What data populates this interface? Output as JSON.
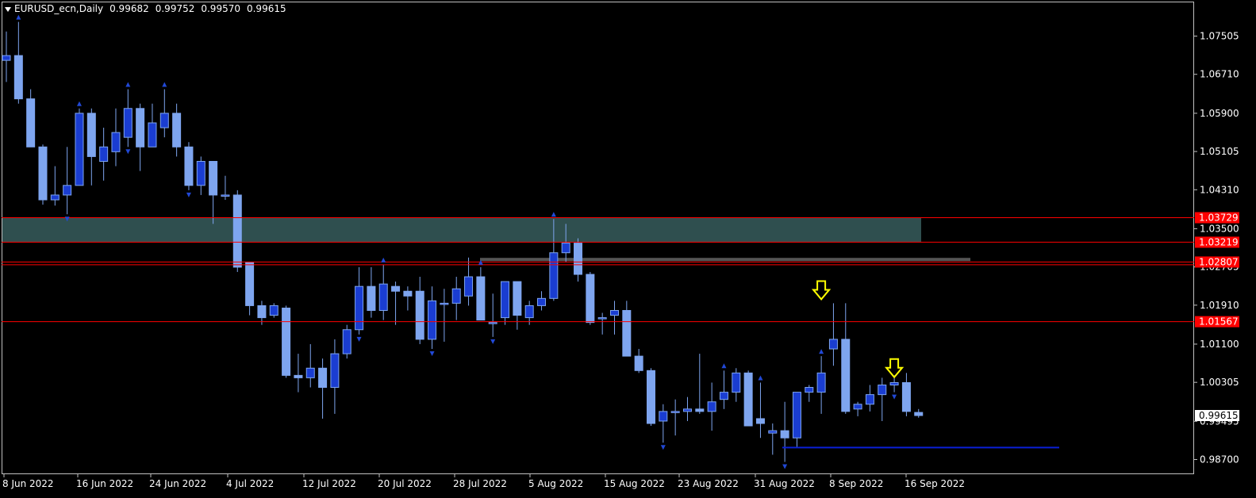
{
  "header": {
    "symbol": "EURUSD_ecn,Daily",
    "open": "0.99682",
    "high": "0.99752",
    "low": "0.99570",
    "close": "0.99615"
  },
  "colors": {
    "background": "#000000",
    "bull": "#1a3dd1",
    "bear": "#7ea5ef",
    "zone_fill": "#2f4f4f",
    "level_line": "#ff0000",
    "support_line": "#0a1fd6",
    "arrow": "#ffff00",
    "price_tag": "#ff0000"
  },
  "chart_data": {
    "type": "candlestick",
    "title": "EURUSD_ecn,Daily",
    "timeframe": "Daily",
    "ylim": [
      0.9815,
      1.082
    ],
    "y_ticks": [
      "1.07505",
      "1.06710",
      "1.05900",
      "1.05105",
      "1.04310",
      "1.03500",
      "1.02705",
      "1.01910",
      "1.01100",
      "1.00305",
      "0.99495",
      "0.98700"
    ],
    "x_ticks": [
      "8 Jun 2022",
      "16 Jun 2022",
      "24 Jun 2022",
      "4 Jul 2022",
      "12 Jul 2022",
      "20 Jul 2022",
      "28 Jul 2022",
      "5 Aug 2022",
      "15 Aug 2022",
      "23 Aug 2022",
      "31 Aug 2022",
      "8 Sep 2022",
      "16 Sep 2022"
    ],
    "current_price": "0.99615",
    "levels": [
      {
        "label": "1.03729",
        "value": 1.03729
      },
      {
        "label": "1.03219",
        "value": 1.03219
      },
      {
        "label": "1.02807",
        "value": 1.02807
      },
      {
        "label": "1.01567",
        "value": 1.01567
      }
    ],
    "zone": {
      "low": 1.03219,
      "high": 1.03729
    },
    "thin_zone_value": 1.0286,
    "support": 0.9895,
    "arrows": [
      {
        "date": "2022-09-08",
        "price": 1.0218
      },
      {
        "date": "2022-09-16",
        "price": 1.0056
      }
    ],
    "candles": [
      {
        "date": "2022-06-07",
        "o": 1.07,
        "h": 1.076,
        "l": 1.0655,
        "c": 1.071
      },
      {
        "date": "2022-06-08",
        "o": 1.071,
        "h": 1.078,
        "l": 1.061,
        "c": 1.062
      },
      {
        "date": "2022-06-09",
        "o": 1.062,
        "h": 1.064,
        "l": 1.052,
        "c": 1.052
      },
      {
        "date": "2022-06-10",
        "o": 1.052,
        "h": 1.0525,
        "l": 1.04,
        "c": 1.041
      },
      {
        "date": "2022-06-13",
        "o": 1.041,
        "h": 1.048,
        "l": 1.0398,
        "c": 1.042
      },
      {
        "date": "2022-06-14",
        "o": 1.042,
        "h": 1.052,
        "l": 1.038,
        "c": 1.044
      },
      {
        "date": "2022-06-15",
        "o": 1.044,
        "h": 1.06,
        "l": 1.044,
        "c": 1.059
      },
      {
        "date": "2022-06-16",
        "o": 1.059,
        "h": 1.06,
        "l": 1.044,
        "c": 1.05
      },
      {
        "date": "2022-06-17",
        "o": 1.049,
        "h": 1.056,
        "l": 1.045,
        "c": 1.052
      },
      {
        "date": "2022-06-20",
        "o": 1.051,
        "h": 1.06,
        "l": 1.048,
        "c": 1.055
      },
      {
        "date": "2022-06-21",
        "o": 1.054,
        "h": 1.064,
        "l": 1.052,
        "c": 1.06
      },
      {
        "date": "2022-06-22",
        "o": 1.06,
        "h": 1.061,
        "l": 1.047,
        "c": 1.052
      },
      {
        "date": "2022-06-23",
        "o": 1.052,
        "h": 1.061,
        "l": 1.052,
        "c": 1.057
      },
      {
        "date": "2022-06-24",
        "o": 1.056,
        "h": 1.064,
        "l": 1.054,
        "c": 1.059
      },
      {
        "date": "2022-06-27",
        "o": 1.059,
        "h": 1.061,
        "l": 1.05,
        "c": 1.052
      },
      {
        "date": "2022-06-28",
        "o": 1.052,
        "h": 1.053,
        "l": 1.043,
        "c": 1.044
      },
      {
        "date": "2022-06-29",
        "o": 1.044,
        "h": 1.05,
        "l": 1.042,
        "c": 1.049
      },
      {
        "date": "2022-06-30",
        "o": 1.049,
        "h": 1.049,
        "l": 1.036,
        "c": 1.042
      },
      {
        "date": "2022-07-01",
        "o": 1.042,
        "h": 1.046,
        "l": 1.041,
        "c": 1.042
      },
      {
        "date": "2022-07-04",
        "o": 1.042,
        "h": 1.043,
        "l": 1.026,
        "c": 1.027
      },
      {
        "date": "2022-07-05",
        "o": 1.028,
        "h": 1.028,
        "l": 1.017,
        "c": 1.019
      },
      {
        "date": "2022-07-06",
        "o": 1.019,
        "h": 1.02,
        "l": 1.015,
        "c": 1.0165
      },
      {
        "date": "2022-07-07",
        "o": 1.017,
        "h": 1.0195,
        "l": 1.0165,
        "c": 1.019
      },
      {
        "date": "2022-07-08",
        "o": 1.0185,
        "h": 1.019,
        "l": 1.004,
        "c": 1.0045
      },
      {
        "date": "2022-07-11",
        "o": 1.0045,
        "h": 1.009,
        "l": 1.001,
        "c": 1.004
      },
      {
        "date": "2022-07-12",
        "o": 1.004,
        "h": 1.011,
        "l": 1.002,
        "c": 1.006
      },
      {
        "date": "2022-07-13",
        "o": 1.006,
        "h": 1.008,
        "l": 0.9955,
        "c": 1.002
      },
      {
        "date": "2022-07-14",
        "o": 1.002,
        "h": 1.012,
        "l": 0.9965,
        "c": 1.009
      },
      {
        "date": "2022-07-15",
        "o": 1.009,
        "h": 1.015,
        "l": 1.008,
        "c": 1.014
      },
      {
        "date": "2022-07-18",
        "o": 1.014,
        "h": 1.027,
        "l": 1.013,
        "c": 1.023
      },
      {
        "date": "2022-07-19",
        "o": 1.023,
        "h": 1.027,
        "l": 1.0165,
        "c": 1.018
      },
      {
        "date": "2022-07-20",
        "o": 1.018,
        "h": 1.0275,
        "l": 1.016,
        "c": 1.0235
      },
      {
        "date": "2022-07-21",
        "o": 1.023,
        "h": 1.024,
        "l": 1.015,
        "c": 1.022
      },
      {
        "date": "2022-07-22",
        "o": 1.022,
        "h": 1.023,
        "l": 1.018,
        "c": 1.021
      },
      {
        "date": "2022-07-25",
        "o": 1.022,
        "h": 1.025,
        "l": 1.011,
        "c": 1.012
      },
      {
        "date": "2022-07-26",
        "o": 1.012,
        "h": 1.023,
        "l": 1.01,
        "c": 1.02
      },
      {
        "date": "2022-07-27",
        "o": 1.0195,
        "h": 1.0225,
        "l": 1.0115,
        "c": 1.0195
      },
      {
        "date": "2022-07-28",
        "o": 1.0195,
        "h": 1.025,
        "l": 1.016,
        "c": 1.0225
      },
      {
        "date": "2022-07-29",
        "o": 1.021,
        "h": 1.029,
        "l": 1.019,
        "c": 1.025
      },
      {
        "date": "2022-08-01",
        "o": 1.025,
        "h": 1.027,
        "l": 1.016,
        "c": 1.016
      },
      {
        "date": "2022-08-02",
        "o": 1.0155,
        "h": 1.0215,
        "l": 1.0125,
        "c": 1.0155
      },
      {
        "date": "2022-08-03",
        "o": 1.0165,
        "h": 1.024,
        "l": 1.015,
        "c": 1.024
      },
      {
        "date": "2022-08-04",
        "o": 1.024,
        "h": 1.024,
        "l": 1.014,
        "c": 1.017
      },
      {
        "date": "2022-08-05",
        "o": 1.0165,
        "h": 1.02,
        "l": 1.015,
        "c": 1.019
      },
      {
        "date": "2022-08-08",
        "o": 1.019,
        "h": 1.022,
        "l": 1.018,
        "c": 1.0205
      },
      {
        "date": "2022-08-09",
        "o": 1.0205,
        "h": 1.037,
        "l": 1.02,
        "c": 1.03
      },
      {
        "date": "2022-08-10",
        "o": 1.03,
        "h": 1.036,
        "l": 1.028,
        "c": 1.032
      },
      {
        "date": "2022-08-11",
        "o": 1.032,
        "h": 1.033,
        "l": 1.024,
        "c": 1.0255
      },
      {
        "date": "2022-08-12",
        "o": 1.0255,
        "h": 1.026,
        "l": 1.015,
        "c": 1.0155
      },
      {
        "date": "2022-08-15",
        "o": 1.0165,
        "h": 1.0175,
        "l": 1.013,
        "c": 1.0165
      },
      {
        "date": "2022-08-16",
        "o": 1.017,
        "h": 1.02,
        "l": 1.013,
        "c": 1.018
      },
      {
        "date": "2022-08-17",
        "o": 1.018,
        "h": 1.02,
        "l": 1.0085,
        "c": 1.0085
      },
      {
        "date": "2022-08-18",
        "o": 1.0085,
        "h": 1.01,
        "l": 1.005,
        "c": 1.0055
      },
      {
        "date": "2022-08-19",
        "o": 1.0055,
        "h": 1.006,
        "l": 0.994,
        "c": 0.9945
      },
      {
        "date": "2022-08-22",
        "o": 0.995,
        "h": 0.9985,
        "l": 0.9905,
        "c": 0.997
      },
      {
        "date": "2022-08-23",
        "o": 0.997,
        "h": 0.9995,
        "l": 0.992,
        "c": 0.997
      },
      {
        "date": "2022-08-24",
        "o": 0.997,
        "h": 1.0,
        "l": 0.995,
        "c": 0.9975
      },
      {
        "date": "2022-08-25",
        "o": 0.9975,
        "h": 1.009,
        "l": 0.9965,
        "c": 0.997
      },
      {
        "date": "2022-08-26",
        "o": 0.997,
        "h": 1.003,
        "l": 0.993,
        "c": 0.999
      },
      {
        "date": "2022-08-29",
        "o": 0.9995,
        "h": 1.0055,
        "l": 0.9975,
        "c": 1.001
      },
      {
        "date": "2022-08-30",
        "o": 1.001,
        "h": 1.006,
        "l": 0.999,
        "c": 1.005
      },
      {
        "date": "2022-08-31",
        "o": 1.005,
        "h": 1.0055,
        "l": 0.994,
        "c": 0.994
      },
      {
        "date": "2022-09-01",
        "o": 0.9955,
        "h": 1.003,
        "l": 0.9915,
        "c": 0.9945
      },
      {
        "date": "2022-09-02",
        "o": 0.9925,
        "h": 0.9945,
        "l": 0.988,
        "c": 0.993
      },
      {
        "date": "2022-09-05",
        "o": 0.993,
        "h": 0.999,
        "l": 0.9865,
        "c": 0.9915
      },
      {
        "date": "2022-09-06",
        "o": 0.9915,
        "h": 1.001,
        "l": 0.9895,
        "c": 1.001
      },
      {
        "date": "2022-09-07",
        "o": 1.001,
        "h": 1.0025,
        "l": 0.999,
        "c": 1.002
      },
      {
        "date": "2022-09-08",
        "o": 1.001,
        "h": 1.0085,
        "l": 0.9965,
        "c": 1.005
      },
      {
        "date": "2022-09-09",
        "o": 1.01,
        "h": 1.0195,
        "l": 1.0065,
        "c": 1.012
      },
      {
        "date": "2022-09-12",
        "o": 1.012,
        "h": 1.0195,
        "l": 0.9965,
        "c": 0.997
      },
      {
        "date": "2022-09-13",
        "o": 0.9975,
        "h": 0.999,
        "l": 0.996,
        "c": 0.9985
      },
      {
        "date": "2022-09-14",
        "o": 0.9985,
        "h": 1.0025,
        "l": 0.997,
        "c": 1.0005
      },
      {
        "date": "2022-09-15",
        "o": 1.0005,
        "h": 1.004,
        "l": 0.995,
        "c": 1.0025
      },
      {
        "date": "2022-09-16",
        "o": 1.0025,
        "h": 1.0045,
        "l": 1.001,
        "c": 1.003
      },
      {
        "date": "2022-09-19",
        "o": 1.003,
        "h": 1.005,
        "l": 0.996,
        "c": 0.997
      },
      {
        "date": "2022-09-20",
        "o": 0.9968,
        "h": 0.9975,
        "l": 0.9957,
        "c": 0.99615
      }
    ]
  }
}
